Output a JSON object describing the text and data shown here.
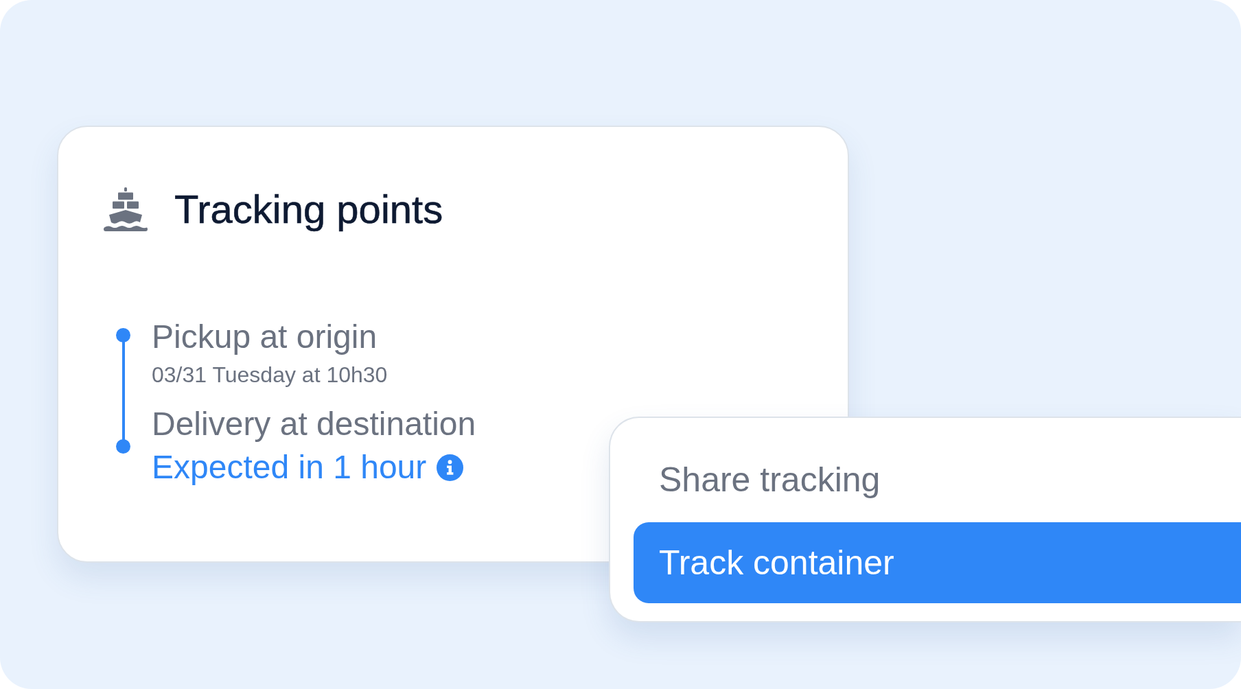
{
  "card": {
    "title": "Tracking points",
    "points": [
      {
        "label": "Pickup at origin",
        "detail": "03/31 Tuesday at 10h30",
        "kind": "time"
      },
      {
        "label": "Delivery at destination",
        "detail": "Expected in 1 hour",
        "kind": "eta"
      }
    ]
  },
  "menu": {
    "items": [
      {
        "label": "Share tracking",
        "selected": false
      },
      {
        "label": "Track container",
        "selected": true
      }
    ]
  }
}
